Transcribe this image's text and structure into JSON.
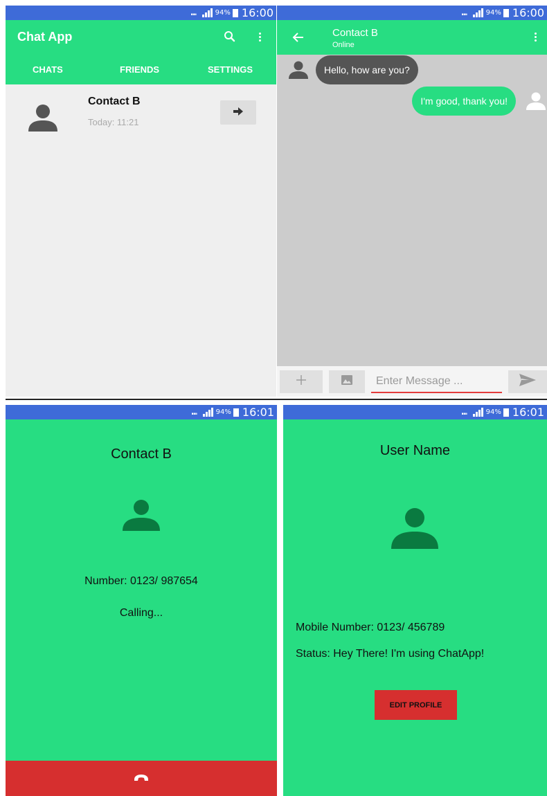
{
  "colors": {
    "status_bar": "#3e6bd8",
    "accent_green": "#27dd82",
    "chat_background": "#cccccc",
    "list_background": "#efefef",
    "incoming_bubble": "#555555",
    "danger_red": "#d62f2f",
    "avatar_dark_green": "#0a7a40"
  },
  "status_bar": {
    "battery_percent": "94%",
    "time_first_row": "16:00",
    "time_second_row": "16:01",
    "icons": [
      "mute-icon",
      "signal-icon",
      "battery-icon"
    ]
  },
  "chat_list_screen": {
    "app_title": "Chat App",
    "toolbar_icons": [
      "search-icon",
      "more-vert-icon"
    ],
    "tabs": [
      {
        "label": "CHATS",
        "selected": true
      },
      {
        "label": "FRIENDS",
        "selected": false
      },
      {
        "label": "SETTINGS",
        "selected": false
      }
    ],
    "chats": [
      {
        "name": "Contact B",
        "time": "Today: 11:21",
        "open_icon": "arrow-right-icon"
      }
    ]
  },
  "conversation_screen": {
    "contact_name": "Contact B",
    "contact_status": "Online",
    "messages": [
      {
        "direction": "incoming",
        "text": "Hello, how are you?"
      },
      {
        "direction": "outgoing",
        "text": "I'm good, thank you!"
      }
    ],
    "input": {
      "placeholder": "Enter Message ...",
      "value": "",
      "buttons": [
        "add-icon",
        "image-icon",
        "send-icon"
      ]
    }
  },
  "call_screen": {
    "contact_name": "Contact B",
    "number_text": "Number: 0123/ 987654",
    "status_text": "Calling...",
    "hangup_icon": "call-end-icon"
  },
  "profile_screen": {
    "user_name": "User Name",
    "mobile_text": "Mobile Number: 0123/ 456789",
    "status_text": "Status: Hey There! I'm using ChatApp!",
    "edit_button_label": "EDIT PROFILE"
  }
}
